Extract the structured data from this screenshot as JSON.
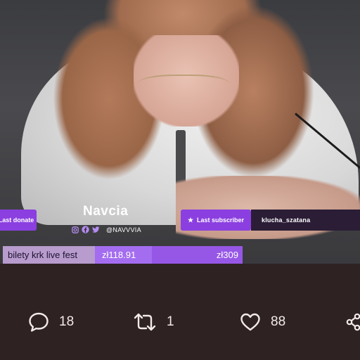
{
  "overlay": {
    "donate_label": "Last donate",
    "subscriber_label": "Last subscriber",
    "subscriber_name": "klucha_szatana",
    "streamer_name": "Navcia",
    "handle": "@NAVVVIA",
    "icons": [
      "instagram-icon",
      "facebook-icon",
      "twitter-icon",
      "star-icon"
    ],
    "goal": {
      "label": "bilety krk live fest",
      "current": "zł118.91",
      "target": "zł309",
      "progress_fraction": 0.385
    },
    "accent_color": "#8b3fe0"
  },
  "post_actions": {
    "reply_count": "18",
    "repost_count": "1",
    "like_count": "88"
  },
  "colors": {
    "background": "#2f2223",
    "action_text": "#f2eaea"
  }
}
